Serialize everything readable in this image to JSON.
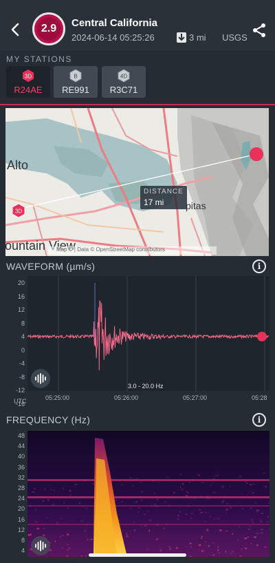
{
  "header": {
    "magnitude": "2.9",
    "title": "Central California",
    "datetime": "2024-06-14 05:25:26",
    "distance": "3 mi",
    "source": "USGS"
  },
  "stations": {
    "label": "MY STATIONS",
    "items": [
      {
        "type": "3D",
        "code": "R24AE",
        "active": true
      },
      {
        "type": "B",
        "code": "RE991",
        "active": false
      },
      {
        "type": "4D",
        "code": "R3C71",
        "active": false
      }
    ]
  },
  "map": {
    "place_labels": [
      "Alto",
      "ountain View",
      "pitas"
    ],
    "station_marker": "3D",
    "distance_label": "DISTANCE",
    "distance_value": "17 mi",
    "attribution": "Map © | Data © OpenStreetMap contributors"
  },
  "waveform": {
    "title": "WAVEFORM (µm/s)",
    "y_ticks": [
      "20",
      "16",
      "12",
      "8",
      "4",
      "0",
      "-4",
      "-8",
      "-12",
      "-16"
    ],
    "x_ticks": [
      "05:25:00",
      "05:26:00",
      "05:27:00",
      "05:28"
    ],
    "x_axis_label": "UTC",
    "filter": "3.0 - 20.0 Hz"
  },
  "frequency": {
    "title": "FREQUENCY (Hz)",
    "y_ticks": [
      "48",
      "44",
      "40",
      "36",
      "32",
      "28",
      "24",
      "20",
      "16",
      "12",
      "8",
      "4"
    ]
  },
  "icons": {
    "back": "chevron-left-icon",
    "share": "share-icon",
    "info": "info-icon",
    "sound": "sound-wave-icon"
  },
  "colors": {
    "accent": "#e8325c",
    "magnitude": "#b8104a",
    "waveform": "#f56a8a"
  }
}
